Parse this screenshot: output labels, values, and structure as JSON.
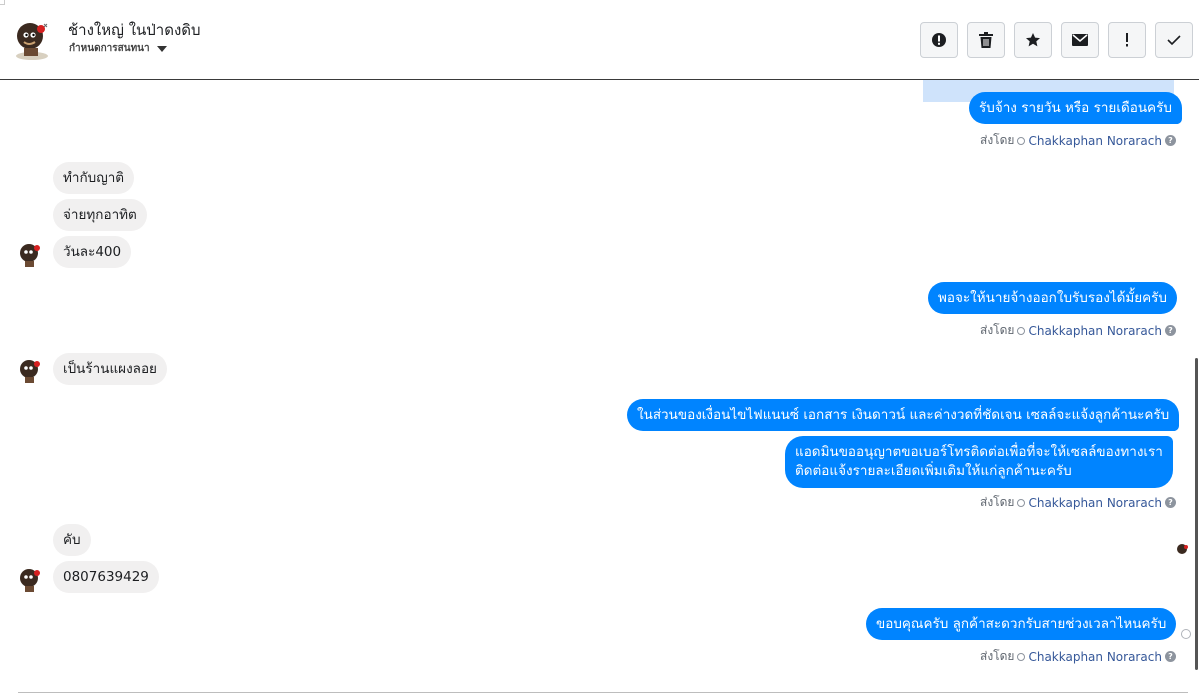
{
  "header": {
    "title": "ช้างใหญ่ ในป่าดงดิบ",
    "subtitle": "กำหนดการสนทนา",
    "actions": [
      {
        "name": "report-button",
        "icon": "alert-circle-icon"
      },
      {
        "name": "delete-button",
        "icon": "trash-icon"
      },
      {
        "name": "star-button",
        "icon": "star-icon"
      },
      {
        "name": "mark-unread-button",
        "icon": "envelope-icon"
      },
      {
        "name": "mark-spam-button",
        "icon": "exclamation-icon"
      },
      {
        "name": "mark-done-button",
        "icon": "check-icon"
      }
    ]
  },
  "colors": {
    "outgoing_bubble": "#0084ff",
    "incoming_bubble": "#f1f0f0",
    "sender_name": "#365899"
  },
  "sent_by_prefix": "ส่งโดย",
  "sent_by_name": "Chakkaphan Norarach",
  "messages": {
    "m1": "รับจ้าง รายวัน หรือ รายเดือนครับ",
    "m2": "ทำกับญาติ",
    "m3": "จ่ายทุกอาทิต",
    "m4": "วันละ400",
    "m5": "พอจะให้นายจ้างออกใบรับรองได้มั้ยครับ",
    "m6": "เป็นร้านแผงลอย",
    "m7": "ในส่วนของเงื่อนไขไฟแนนซ์ เอกสาร เงินดาวน์ และค่างวดที่ชัดเจน เซลล์จะแจ้งลูกค้านะครับ",
    "m8_line1": "แอดมินขออนุญาตขอเบอร์โทรติดต่อเพื่อที่จะให้เซลล์ของทางเรา",
    "m8_line2": "ติดต่อแจ้งรายละเอียดเพิ่มเติมให้แก่ลูกค้านะครับ",
    "m9": "คับ",
    "m10": "0807639429",
    "m11": "ขอบคุณครับ ลูกค้าสะดวกรับสายช่วงเวลาไหนครับ"
  }
}
